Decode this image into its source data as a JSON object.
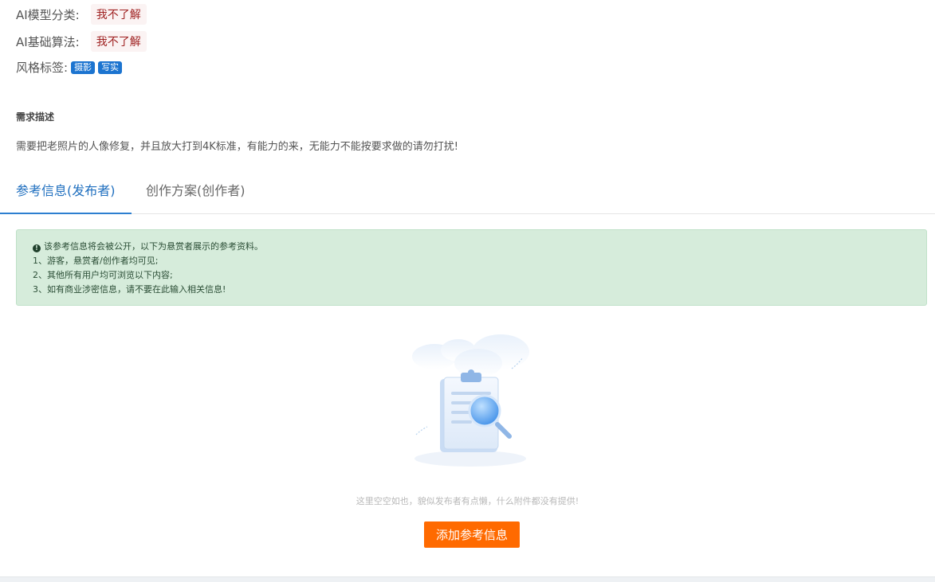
{
  "info": {
    "model_class_label": "AI模型分类:",
    "model_class_value": "我不了解",
    "algorithm_label": "AI基础算法:",
    "algorithm_value": "我不了解",
    "style_tags_label": "风格标签:",
    "style_tags": [
      "摄影",
      "写实"
    ]
  },
  "requirement": {
    "title": "需求描述",
    "text": "需要把老照片的人像修复，并且放大打到4K标准，有能力的来，无能力不能按要求做的请勿打扰!"
  },
  "tabs": [
    {
      "label": "参考信息(发布者)",
      "active": true
    },
    {
      "label": "创作方案(创作者)",
      "active": false
    }
  ],
  "notice": {
    "lines": [
      "该参考信息将会被公开，以下为悬赏者展示的参考资料。",
      "1、游客，悬赏者/创作者均可见;",
      "2、其他所有用户均可浏览以下内容;",
      "3、如有商业涉密信息，请不要在此输入相关信息!"
    ]
  },
  "empty_state": {
    "icon": "clipboard-search-illustration",
    "text": "这里空空如也，貌似发布者有点懒，什么附件都没有提供!"
  },
  "actions": {
    "add_reference_label": "添加参考信息"
  },
  "colors": {
    "accent": "#1f6fbf",
    "button": "#ff6a00",
    "notice_bg": "#d6ecdb",
    "tag_bg": "#1c74d0",
    "value_text": "#9e1f1f"
  }
}
